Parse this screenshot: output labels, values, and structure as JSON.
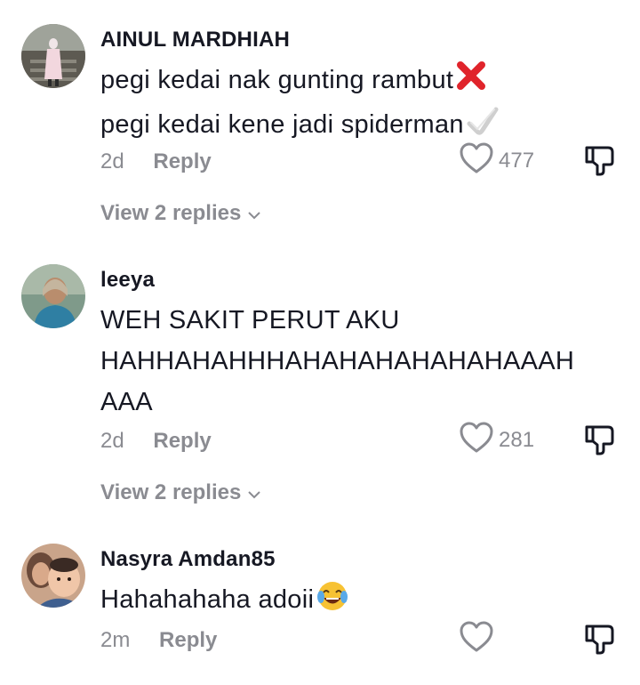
{
  "comments": [
    {
      "username": "AINUL MARDHIAH",
      "text_lines": [
        "pegi kedai nak gunting rambut",
        "pegi kedai kene jadi spiderman"
      ],
      "emoji_line1": "cross-mark-emoji",
      "emoji_line2": "check-mark-emoji",
      "time": "2d",
      "reply_label": "Reply",
      "likes": "477",
      "view_replies": "View 2 replies"
    },
    {
      "username": "leeya",
      "text_lines": [
        "WEH SAKIT PERUT AKU",
        "HAHHAHAHHHAHAHAHAHAHAHAAAH",
        "AAA"
      ],
      "time": "2d",
      "reply_label": "Reply",
      "likes": "281",
      "view_replies": "View 2 replies"
    },
    {
      "username": "Nasyra Amdan85",
      "text_lines": [
        "Hahahahaha adoii"
      ],
      "emoji_line1": "tears-of-joy-emoji",
      "time": "2m",
      "reply_label": "Reply",
      "likes": ""
    }
  ],
  "colors": {
    "text": "#161823",
    "muted": "#8a8b91",
    "cross": "#e0242b"
  }
}
